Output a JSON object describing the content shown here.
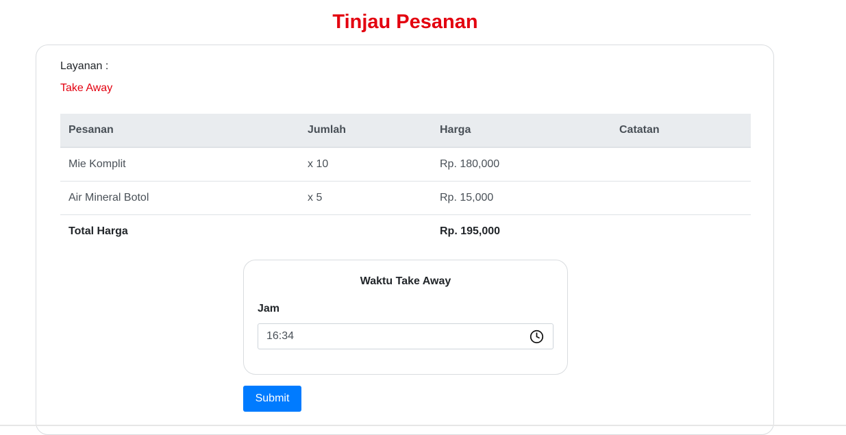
{
  "page": {
    "title": "Tinjau Pesanan"
  },
  "service": {
    "label": "Layanan :",
    "value": "Take Away"
  },
  "orders": {
    "headers": [
      "Pesanan",
      "Jumlah",
      "Harga",
      "Catatan"
    ],
    "rows": [
      {
        "item": "Mie Komplit",
        "qty": "x 10",
        "price": "Rp. 180,000",
        "note": ""
      },
      {
        "item": "Air Mineral Botol",
        "qty": "x 5",
        "price": "Rp. 15,000",
        "note": ""
      }
    ],
    "total": {
      "label": "Total Harga",
      "price": "Rp. 195,000"
    }
  },
  "pickup": {
    "title": "Waktu Take Away",
    "time_label": "Jam",
    "time_value": "16:34",
    "icon": "clock-icon"
  },
  "actions": {
    "submit_label": "Submit"
  },
  "colors": {
    "accent": "#e3000f",
    "primary_button": "#007bff"
  }
}
